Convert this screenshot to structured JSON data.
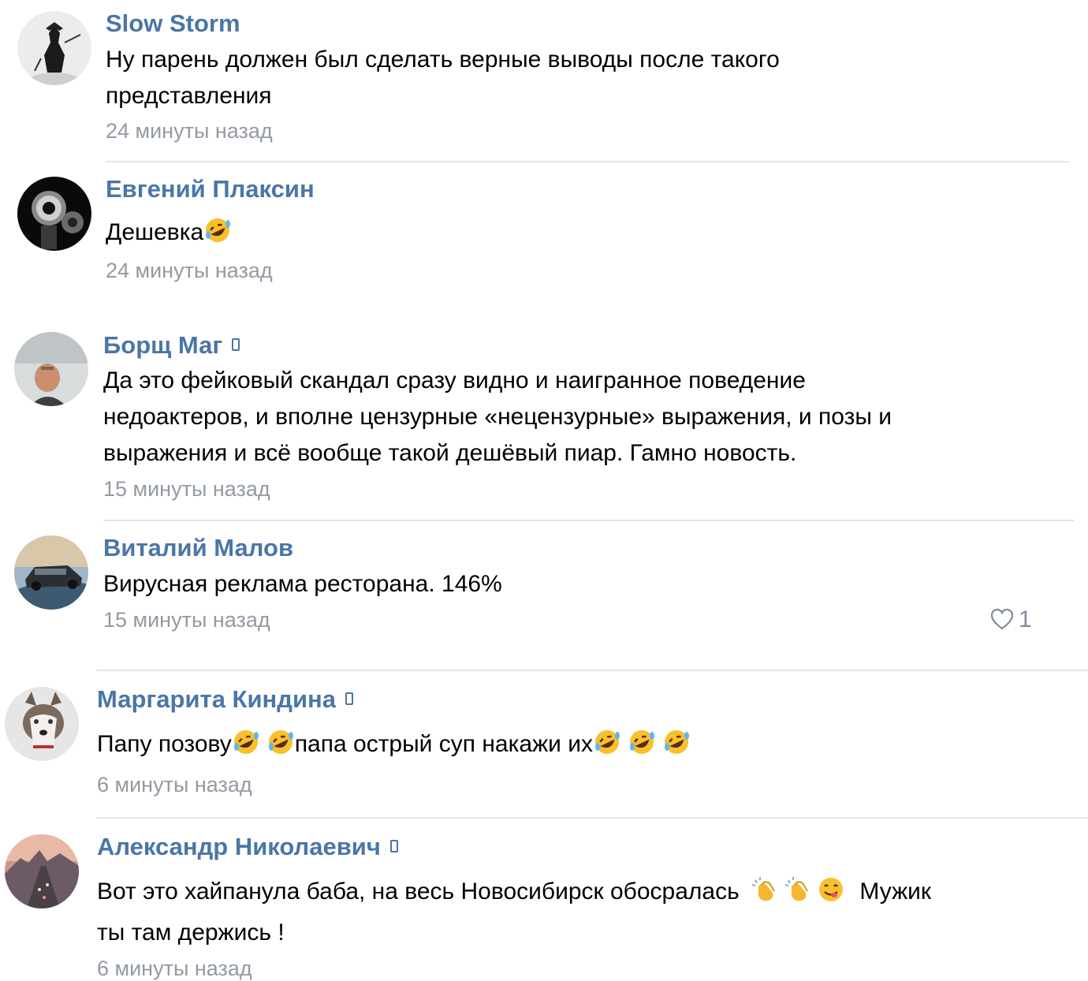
{
  "comments": [
    {
      "author": "Slow Storm",
      "text_lines": [
        "Ну парень должен был сделать верные выводы после такого",
        "представления"
      ],
      "time": "24 минуты назад",
      "avatar": "samurai-avatar"
    },
    {
      "author": "Евгений Плаксин",
      "text": "Дешевка",
      "time": "24 минуты назад",
      "avatar": "revolver-avatar",
      "emoji": "rofl-emoji"
    },
    {
      "author": "Борщ Маг",
      "mobile_icon": "phone-icon",
      "text_lines": [
        "Да это фейковый скандал сразу видно и наигранное поведение",
        "недоактеров, и вполне цензурные «нецензурные» выражения, и позы и",
        "выражения и всё вообще такой дешёвый пиар. Гамно новость."
      ],
      "time": "15 минуты назад",
      "avatar": "man-photo-avatar"
    },
    {
      "author": "Виталий Малов",
      "text": "Вирусная реклама ресторана. 146%",
      "time": "15 минуты назад",
      "avatar": "car-avatar",
      "likes": "1",
      "like_icon": "heart-icon"
    },
    {
      "author": "Маргарита Киндина",
      "mobile_icon": "phone-icon",
      "text_parts": [
        "Папу позову",
        "папа острый суп накажи их"
      ],
      "time": "6 минуты назад",
      "avatar": "husky-avatar"
    },
    {
      "author": "Александр Николаевич",
      "mobile_icon": "phone-icon",
      "text_lines": [
        "Вот это хайпанула баба, на весь Новосибирск обосралась",
        "ты там держись !"
      ],
      "text_tail": "Мужик",
      "time": "6 минуты назад",
      "avatar": "city-avatar",
      "emojis": [
        "clap-emoji",
        "clap-emoji",
        "yum-emoji"
      ]
    }
  ],
  "colors": {
    "author": "#4a76a8",
    "time": "#939aa3",
    "divider": "#e2e5e9",
    "text": "#000000"
  }
}
